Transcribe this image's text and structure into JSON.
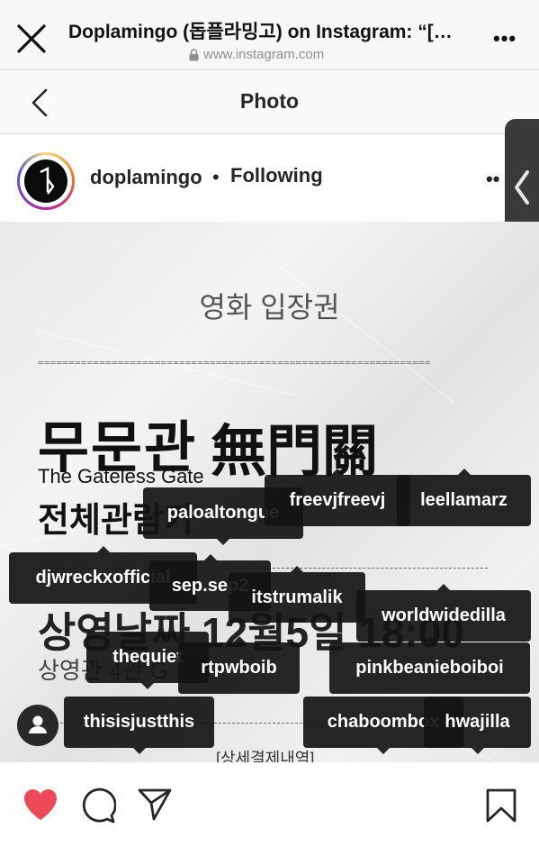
{
  "browser": {
    "title": "Doplamingo (돕플라밍고) on Instagram: “[…",
    "url": "www.instagram.com"
  },
  "header": {
    "title": "Photo"
  },
  "post": {
    "username": "doplamingo",
    "separator": "•",
    "follow_status": "Following"
  },
  "photo": {
    "heading": "영화 입장권",
    "equals_line": "================================================================",
    "title_kr": "무문관",
    "title_hanja": "無門關",
    "title_en": "The Gateless Gate",
    "rating": "전체관람가",
    "date": "상영날짜 12월5일 18:00",
    "hall": "상영관 4관 G",
    "detail": "[상세결제내역]"
  },
  "tags": [
    {
      "label": "freevjfreevj"
    },
    {
      "label": "leellamarz"
    },
    {
      "label": "paloaltongue"
    },
    {
      "label": "djwreckxofficial"
    },
    {
      "label": "sep.sep2"
    },
    {
      "label": "itstrumalik"
    },
    {
      "label": "worldwidedilla"
    },
    {
      "label": "thequiet"
    },
    {
      "label": "rtpwboib"
    },
    {
      "label": "pinkbeanieboiboi"
    },
    {
      "label": "thisisjustthis"
    },
    {
      "label": "chaboombox"
    },
    {
      "label": "hwajilla"
    }
  ],
  "icons": {
    "close": "close-icon",
    "lock": "lock-icon",
    "more": "more-icon",
    "back": "chevron-left-icon",
    "heart": "heart-icon",
    "comment": "comment-icon",
    "share": "send-icon",
    "bookmark": "bookmark-icon",
    "user_tags": "person-icon"
  },
  "colors": {
    "like": "#ed4956",
    "text": "#262626",
    "tag_bg": "#141414"
  }
}
